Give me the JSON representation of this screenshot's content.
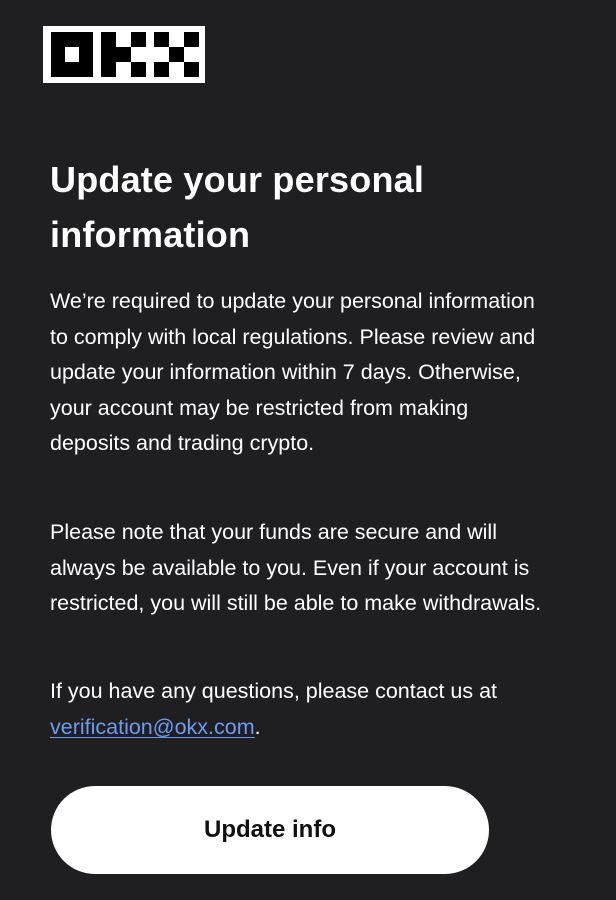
{
  "brand": {
    "logo_text": "OKX",
    "logo_icon": "okx-logo-icon"
  },
  "colors": {
    "background": "#1f1f21",
    "text": "#ffffff",
    "link": "#6e9bf0",
    "button_bg": "#ffffff",
    "button_text": "#111111"
  },
  "content": {
    "title": "Update your personal information",
    "paragraph_1": "We’re required to update your personal information to comply with local regulations. Please review and update your information within 7 days. Otherwise, your account may be restricted from making deposits and trading crypto.",
    "paragraph_2": "Please note that your funds are secure and will always be available to you. Even if your account is restricted, you will still be able to make withdrawals.",
    "paragraph_3_prefix": "If you have any questions, please contact us at ",
    "email": "verification@okx.com",
    "paragraph_3_suffix": "."
  },
  "actions": {
    "update_button_label": "Update info"
  }
}
